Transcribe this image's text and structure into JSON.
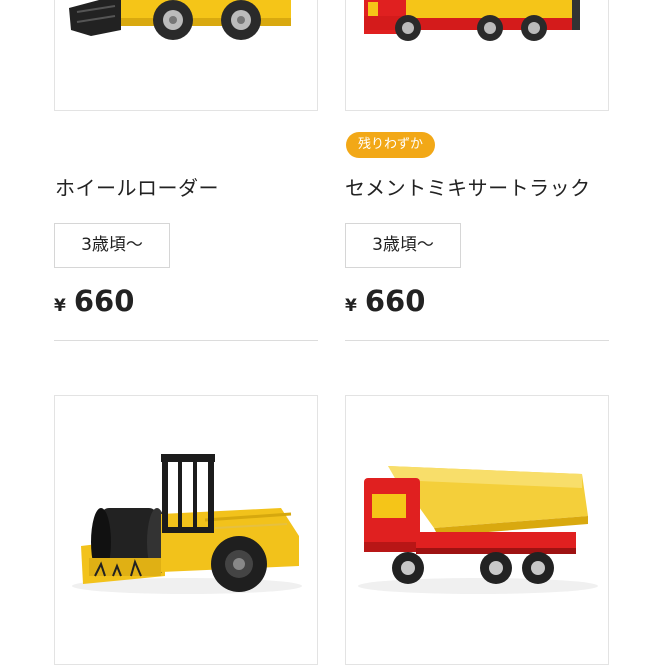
{
  "products": [
    {
      "name": "ホイールローダー",
      "age": "3歳頃〜",
      "currency": "¥",
      "price": "660",
      "badge": "",
      "image_icon": "wheel-loader-image",
      "body_color": "#f5c518"
    },
    {
      "name": "セメントミキサートラック",
      "age": "3歳頃〜",
      "currency": "¥",
      "price": "660",
      "badge": "残りわずか",
      "image_icon": "cement-mixer-truck-image",
      "body_color": "#e02020"
    },
    {
      "name": "",
      "age": "",
      "currency": "",
      "price": "",
      "badge": "",
      "image_icon": "road-roller-image",
      "body_color": "#f2c21b"
    },
    {
      "name": "",
      "age": "",
      "currency": "",
      "price": "",
      "badge": "",
      "image_icon": "dump-truck-image",
      "body_color": "#e02020"
    }
  ],
  "colors": {
    "badge_bg": "#f2a817",
    "border": "#e3e3e3",
    "text": "#222222"
  }
}
